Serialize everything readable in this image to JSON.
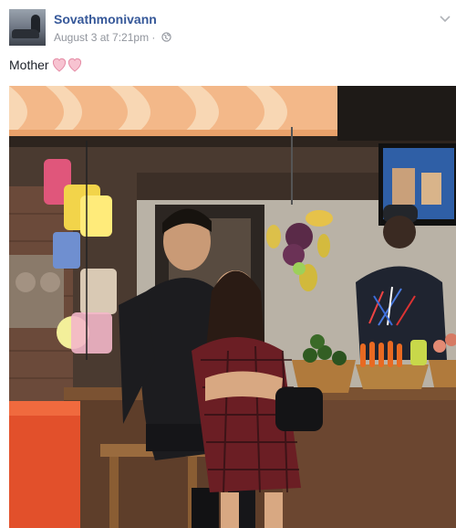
{
  "post": {
    "author": "Sovathmonivann",
    "date_text": "August 3 at 7:21pm",
    "separator": "·",
    "caption": "Mother",
    "privacy_icon": "globe-icon",
    "caption_emoji_icon": "two-hearts-icon"
  },
  "colors": {
    "author_link": "#365899",
    "meta_text": "#90949c",
    "caption_text": "#1d2129",
    "hearts": "#f4a9bd"
  }
}
